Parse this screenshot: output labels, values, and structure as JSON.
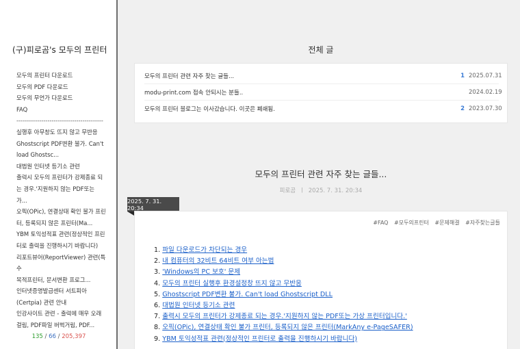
{
  "sidebar": {
    "blog_title": "(구)피로곰's 모두의 프린터",
    "menu": [
      "모두의 프린터 다운로드",
      "모두의 PDF 다운로드",
      "모두의 무언가 다운로드",
      "FAQ",
      "------------------------------------------",
      "실행후 아무창도 뜨지 않고 무반응",
      "Ghostscript PDF변환 불가. Can't",
      "load Ghostsc...",
      "대법원 인터넷 등기소 관련",
      "출력시 모두의 프린터가 강제종료 되",
      "는 경우.'지원하지 않는 PDF또는",
      "가...",
      "오픽(OPic), 연결상태 확인 불가 프린",
      "터, 등록되지 않은 프린터(Ma...",
      "YBM 토익성적표 관련(정상적인 프린",
      "터로 출력을 진행하시기 바랍니다)",
      "리포트뷰어(ReportViewer) 관련(특수",
      "목적프린터, 문서변환 프로그...",
      "인터넷증명발급센터 서트피아",
      "(Certpia) 관련 안내",
      "인강사이트 관련 - 출력에 매우 오래",
      "걸림, PDF파일 버벅거림, PDF..."
    ],
    "counter": {
      "today": "135",
      "yesterday": "66",
      "total": "205,397",
      "sep": " / "
    }
  },
  "list": {
    "title": "전체 글",
    "posts": [
      {
        "title": "모두의 프린터 관련 자주 찾는 글들...",
        "count": "1",
        "date": "2025.07.31"
      },
      {
        "title": "modu-print.com 접속 안되시는 분들..",
        "count": "",
        "date": "2024.02.19"
      },
      {
        "title": "모두의 프린터 블로그는 이사갔습니다. 이곳은 폐쇄됨.",
        "count": "2",
        "date": "2023.07.30"
      }
    ]
  },
  "article": {
    "title": "모두의 프린터 관련 자주 찾는 글들...",
    "author": "피로곰",
    "meta_sep": "ㅣ",
    "datetime": "2025. 7. 31. 20:34",
    "date_tag": "2025. 7. 31. 20:34",
    "tags": [
      "#FAQ",
      "#모두의프린터",
      "#문제해결",
      "#자주찾는글들"
    ],
    "toc": [
      {
        "num": "1.",
        "text": "파일 다운로드가 차단되는 경우"
      },
      {
        "num": "2.",
        "text": "내 컴퓨터의 32비트 64비트 여부 아는법"
      },
      {
        "num": "3.",
        "text": "'Windows의 PC 보호' 문제"
      },
      {
        "num": "4.",
        "text": "모두의 프린터 실행후 환경설정창 뜨지 않고 무반응"
      },
      {
        "num": "5.",
        "text": "Ghostscript PDF변환 불가. Can't load Ghostscript DLL"
      },
      {
        "num": "6.",
        "text": "대법원 인터넷 등기소 관련"
      },
      {
        "num": "7.",
        "text": "출력시 모두의 프린터가 강제종료 되는 경우.'지원하지 않는 PDF또는 가상 프린터입니다.'"
      },
      {
        "num": "8.",
        "text": "오픽(OPic), 연결상태 확인 불가 프린터, 등록되지 않은 프린터(MarkAny e-PageSAFER)"
      },
      {
        "num": "9.",
        "text": "YBM 토익성적표 관련(정상적인 프린터로 출력을 진행하시기 바랍니다)"
      }
    ]
  }
}
